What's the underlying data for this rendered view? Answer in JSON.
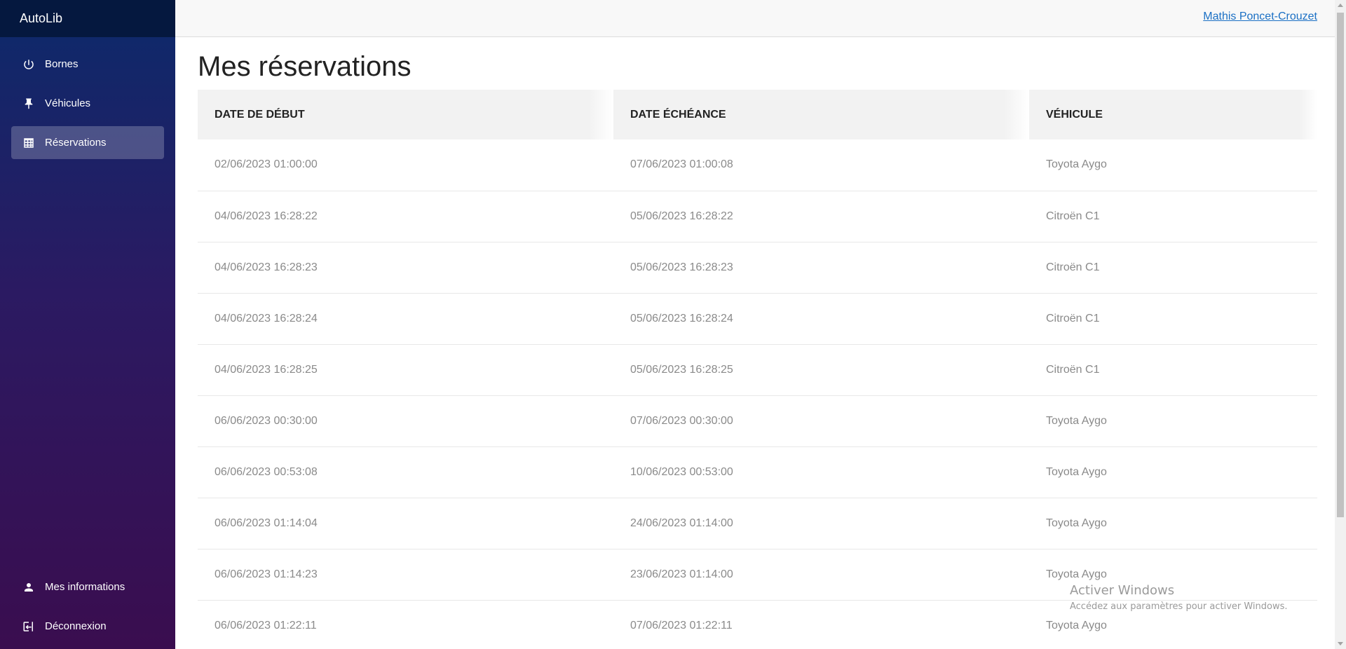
{
  "app": {
    "brand": "AutoLib"
  },
  "sidebar": {
    "items": [
      {
        "label": "Bornes",
        "icon": "power-icon"
      },
      {
        "label": "Véhicules",
        "icon": "pin-icon"
      },
      {
        "label": "Réservations",
        "icon": "calendar-grid-icon",
        "active": true
      }
    ],
    "bottom_items": [
      {
        "label": "Mes informations",
        "icon": "user-icon"
      },
      {
        "label": "Déconnexion",
        "icon": "logout-icon"
      }
    ]
  },
  "header": {
    "user_name": "Mathis Poncet-Crouzet"
  },
  "page": {
    "title": "Mes réservations"
  },
  "table": {
    "columns": [
      "DATE DE DÉBUT",
      "DATE ÉCHÉANCE",
      "VÉHICULE"
    ],
    "rows": [
      [
        "02/06/2023 01:00:00",
        "07/06/2023 01:00:08",
        "Toyota Aygo"
      ],
      [
        "04/06/2023 16:28:22",
        "05/06/2023 16:28:22",
        "Citroën C1"
      ],
      [
        "04/06/2023 16:28:23",
        "05/06/2023 16:28:23",
        "Citroën C1"
      ],
      [
        "04/06/2023 16:28:24",
        "05/06/2023 16:28:24",
        "Citroën C1"
      ],
      [
        "04/06/2023 16:28:25",
        "05/06/2023 16:28:25",
        "Citroën C1"
      ],
      [
        "06/06/2023 00:30:00",
        "07/06/2023 00:30:00",
        "Toyota Aygo"
      ],
      [
        "06/06/2023 00:53:08",
        "10/06/2023 00:53:00",
        "Toyota Aygo"
      ],
      [
        "06/06/2023 01:14:04",
        "24/06/2023 01:14:00",
        "Toyota Aygo"
      ],
      [
        "06/06/2023 01:14:23",
        "23/06/2023 01:14:00",
        "Toyota Aygo"
      ],
      [
        "06/06/2023 01:22:11",
        "07/06/2023 01:22:11",
        "Toyota Aygo"
      ]
    ]
  },
  "watermark": {
    "title": "Activer Windows",
    "subtitle": "Accédez aux paramètres pour activer Windows."
  },
  "colors": {
    "sidebar_top": "#0c2a6b",
    "sidebar_bottom": "#3a0d4f",
    "link": "#1a6fc4"
  }
}
